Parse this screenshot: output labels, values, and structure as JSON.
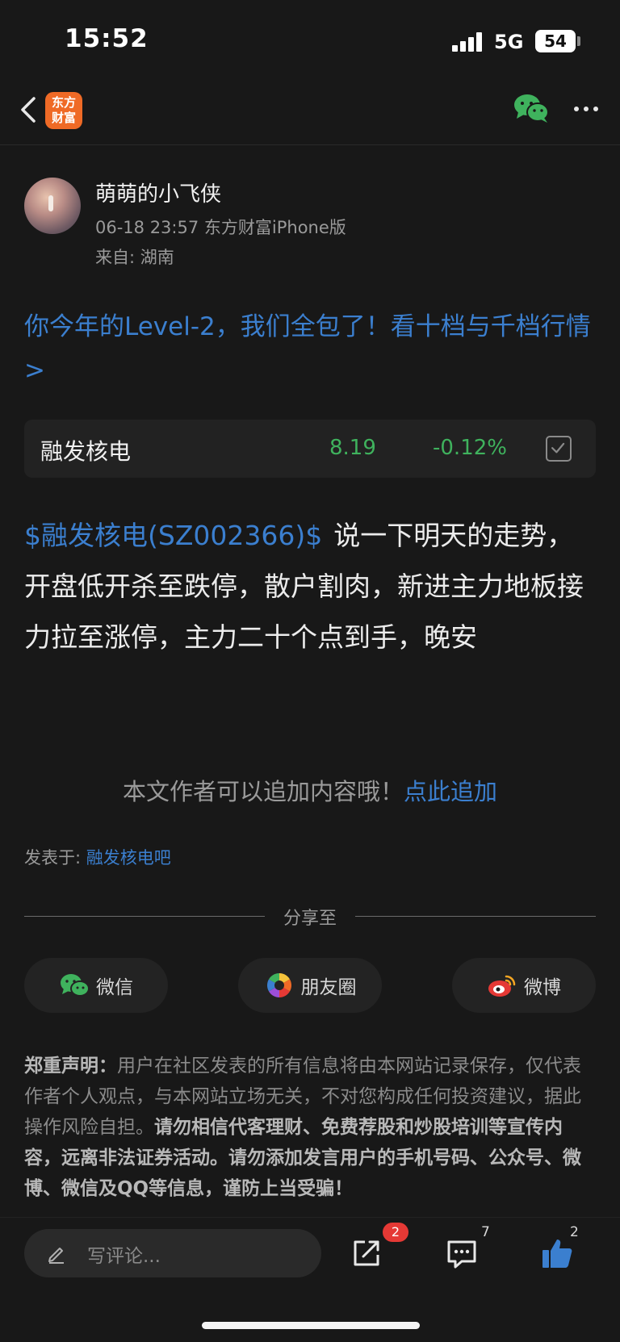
{
  "status_bar": {
    "time": "15:52",
    "network": "5G",
    "battery": "54"
  },
  "navbar": {
    "logo_text_line1": "东方",
    "logo_text_line2": "财富"
  },
  "author": {
    "name": "萌萌的小飞侠",
    "meta": "06-18 23:57 东方财富iPhone版",
    "location": "来自: 湖南"
  },
  "promo_link": "你今年的Level-2，我们全包了！看十档与千档行情>",
  "stock": {
    "name": "融发核电",
    "price": "8.19",
    "change": "-0.12%",
    "color_down": "#3fb25d"
  },
  "post": {
    "tag": "$融发核电(SZ002366)$",
    "text": "说一下明天的走势，开盘低开杀至跌停，散户割肉，新进主力地板接力拉至涨停，主力二十个点到手，晚安"
  },
  "append": {
    "text": "本文作者可以追加内容哦！",
    "link": "点此追加"
  },
  "posted_in": {
    "label": "发表于: ",
    "bar": "融发核电吧"
  },
  "share": {
    "label": "分享至",
    "buttons": [
      {
        "label": "微信",
        "icon": "wechat-icon"
      },
      {
        "label": "朋友圈",
        "icon": "moments-icon"
      },
      {
        "label": "微博",
        "icon": "weibo-icon"
      }
    ]
  },
  "disclaimer": {
    "title": "郑重声明：",
    "body": "用户在社区发表的所有信息将由本网站记录保存，仅代表作者个人观点，与本网站立场无关，不对您构成任何投资建议，据此操作风险自担。",
    "bold": "请勿相信代客理财、免费荐股和炒股培训等宣传内容，远离非法证券活动。请勿添加发言用户的手机号码、公众号、微博、微信及QQ等信息，谨防上当受骗！"
  },
  "bottom_bar": {
    "comment_placeholder": "写评论...",
    "share_badge": "2",
    "comments_count": "7",
    "likes_count": "2"
  },
  "colors": {
    "background": "#181818",
    "link": "#3b7fcf",
    "brand": "#ef6a26",
    "badge": "#e53935"
  }
}
